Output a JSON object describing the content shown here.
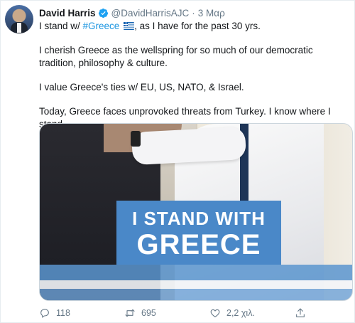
{
  "tweet": {
    "display_name": "David Harris",
    "handle": "@DavidHarrisAJC",
    "separator": "·",
    "time": "3 Μαρ",
    "line1_before": "I stand w/ ",
    "line1_hashtag": "#Greece",
    "line1_after": ", as I have for the past 30 yrs.",
    "para2": "I cherish Greece as the wellspring for so much of our democratic tradition, philosophy & culture.",
    "para3": "I value Greece's ties w/ EU, US, NATO, & Israel.",
    "para4": "Today, Greece faces unprovoked threats from Turkey. I know where I stand."
  },
  "media": {
    "banner_line1": "I STAND WITH",
    "banner_line2": "GREECE"
  },
  "actions": {
    "replies": "118",
    "retweets": "695",
    "likes": "2,2 χιλ."
  },
  "colors": {
    "link": "#1b95e0",
    "verified": "#1da1f2",
    "banner": "#4a88c8",
    "muted": "#657786"
  },
  "icons": [
    "verified-badge-icon",
    "greek-flag-icon",
    "reply-icon",
    "retweet-icon",
    "like-icon",
    "share-icon"
  ]
}
